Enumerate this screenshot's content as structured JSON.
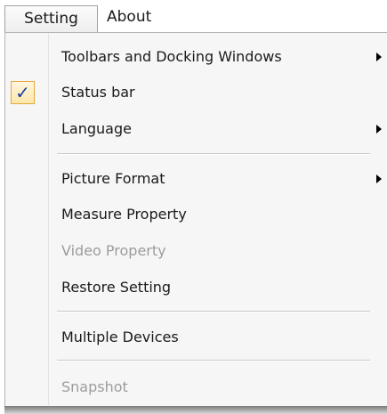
{
  "menubar": {
    "setting_label": "Setting",
    "about_label": "About"
  },
  "menu": {
    "items": [
      {
        "label": "Toolbars and Docking Windows",
        "submenu": true,
        "enabled": true,
        "checked": false
      },
      {
        "label": "Status bar",
        "submenu": false,
        "enabled": true,
        "checked": true
      },
      {
        "label": "Language",
        "submenu": true,
        "enabled": true,
        "checked": false
      },
      {
        "label": "Picture Format",
        "submenu": true,
        "enabled": true,
        "checked": false
      },
      {
        "label": "Measure Property",
        "submenu": false,
        "enabled": true,
        "checked": false
      },
      {
        "label": "Video Property",
        "submenu": false,
        "enabled": false,
        "checked": false
      },
      {
        "label": "Restore Setting",
        "submenu": false,
        "enabled": true,
        "checked": false
      },
      {
        "label": "Multiple Devices",
        "submenu": false,
        "enabled": true,
        "checked": false
      },
      {
        "label": "Snapshot",
        "submenu": false,
        "enabled": false,
        "checked": false
      }
    ],
    "check_glyph": "✓",
    "colors": {
      "check_mark": "#1a3fa3",
      "check_highlight_border": "#e6a93b",
      "disabled_text": "#9c9c9c"
    }
  }
}
